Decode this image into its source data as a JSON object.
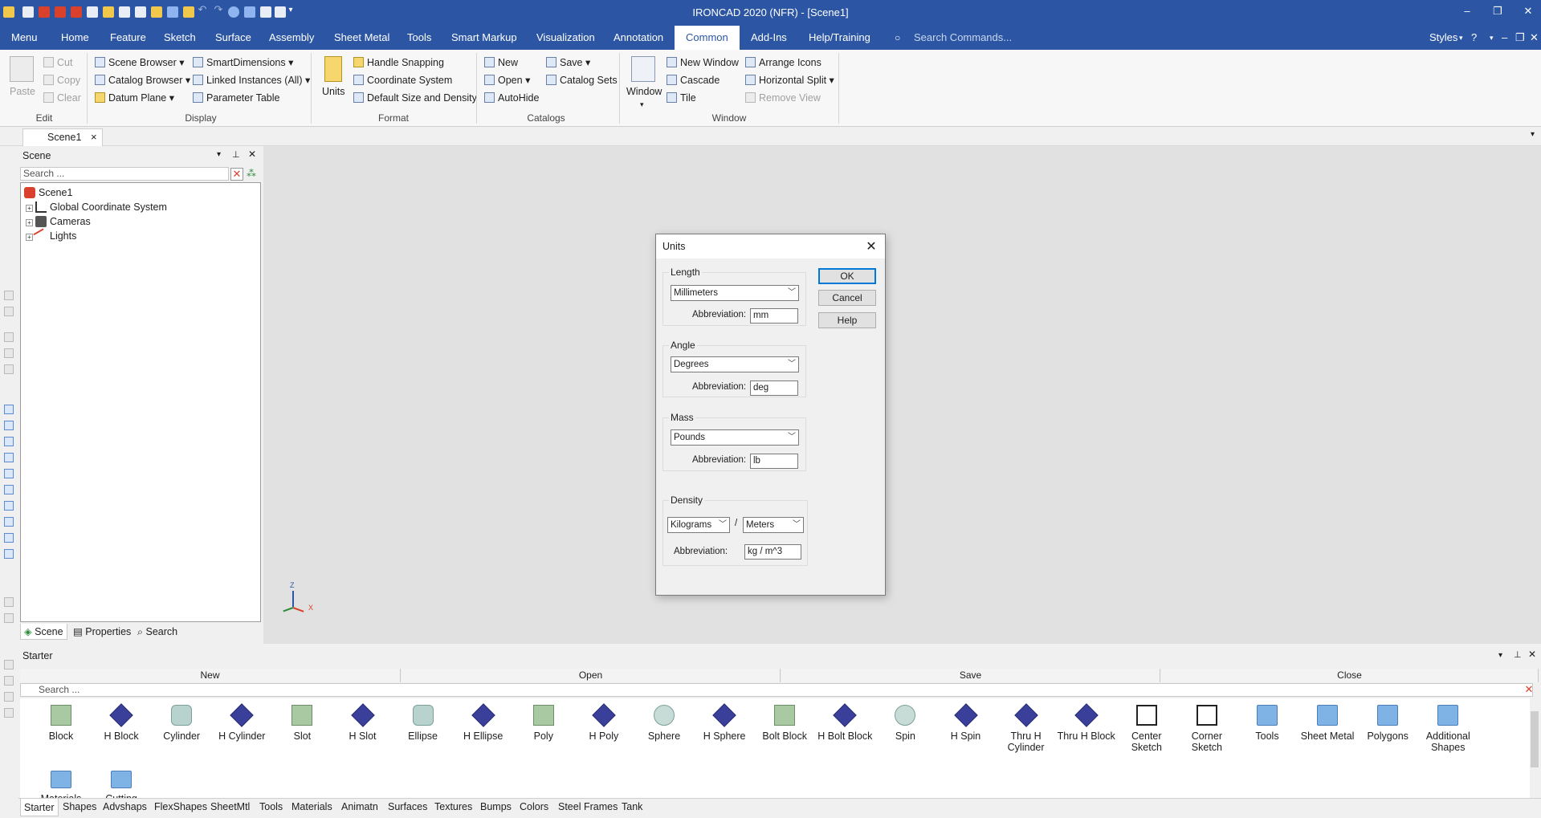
{
  "window": {
    "title": "IRONCAD 2020 (NFR) - [Scene1]",
    "minimize": "–",
    "maximize": "❐",
    "close": "✕"
  },
  "menu_tabs": [
    "Menu",
    "Home",
    "Feature",
    "Sketch",
    "Surface",
    "Assembly",
    "Sheet Metal",
    "Tools",
    "Smart Markup",
    "Visualization",
    "Annotation",
    "Common",
    "Add-Ins",
    "Help/Training"
  ],
  "active_tab": "Common",
  "search_commands": {
    "placeholder": "Search Commands..."
  },
  "styles_label": "Styles",
  "ribbon": {
    "edit": {
      "paste": "Paste",
      "cut": "Cut",
      "copy": "Copy",
      "clear": "Clear",
      "group": "Edit"
    },
    "display": {
      "scene_browser": "Scene Browser",
      "catalog_browser": "Catalog Browser",
      "datum_plane": "Datum Plane",
      "smart_dimensions": "SmartDimensions",
      "linked_instances": "Linked Instances (All)",
      "parameter_table": "Parameter Table",
      "group": "Display"
    },
    "format": {
      "units": "Units",
      "handle_snapping": "Handle Snapping",
      "coordinate_system": "Coordinate System",
      "default_size": "Default Size and Density",
      "group": "Format"
    },
    "catalogs": {
      "new": "New",
      "open": "Open",
      "autohide": "AutoHide",
      "save": "Save",
      "catalog_sets": "Catalog Sets",
      "group": "Catalogs"
    },
    "window": {
      "window": "Window",
      "new_window": "New Window",
      "cascade": "Cascade",
      "tile": "Tile",
      "arrange_icons": "Arrange Icons",
      "horizontal_split": "Horizontal Split",
      "remove_view": "Remove View",
      "group": "Window"
    }
  },
  "doc_tab": {
    "label": "Scene1",
    "close": "×"
  },
  "scene_panel": {
    "title": "Scene",
    "search_placeholder": "Search ...",
    "tree": [
      {
        "label": "Scene1"
      },
      {
        "label": "Global Coordinate System"
      },
      {
        "label": "Cameras"
      },
      {
        "label": "Lights"
      }
    ],
    "tabs": [
      "Scene",
      "Properties",
      "Search"
    ]
  },
  "triad": {
    "z": "Z",
    "x": "X"
  },
  "units_dialog": {
    "title": "Units",
    "close": "✕",
    "length": {
      "label": "Length",
      "value": "Millimeters",
      "abbr_label": "Abbreviation:",
      "abbr": "mm"
    },
    "angle": {
      "label": "Angle",
      "value": "Degrees",
      "abbr_label": "Abbreviation:",
      "abbr": "deg"
    },
    "mass": {
      "label": "Mass",
      "value": "Pounds",
      "abbr_label": "Abbreviation:",
      "abbr": "lb"
    },
    "density": {
      "label": "Density",
      "mass_unit": "Kilograms",
      "divider": "/",
      "length_unit": "Meters",
      "abbr_label": "Abbreviation:",
      "abbr": "kg / m^3"
    },
    "buttons": {
      "ok": "OK",
      "cancel": "Cancel",
      "help": "Help"
    }
  },
  "starter": {
    "title": "Starter",
    "cells": [
      "New",
      "Open",
      "Save",
      "Close"
    ],
    "search_placeholder": "Search ...",
    "shapes_row1": [
      {
        "label": "Block"
      },
      {
        "label": "H Block"
      },
      {
        "label": "Cylinder"
      },
      {
        "label": "H Cylinder"
      },
      {
        "label": "Slot"
      },
      {
        "label": "H Slot"
      },
      {
        "label": "Ellipse"
      },
      {
        "label": "H Ellipse"
      },
      {
        "label": "Poly"
      },
      {
        "label": "H Poly"
      },
      {
        "label": "Sphere"
      },
      {
        "label": "H Sphere"
      },
      {
        "label": "Bolt Block"
      },
      {
        "label": "H Bolt Block"
      },
      {
        "label": "Spin"
      },
      {
        "label": "H Spin"
      },
      {
        "label": "Thru H\nCylinder"
      },
      {
        "label": "Thru H Block"
      },
      {
        "label": "Center\nSketch"
      },
      {
        "label": "Corner\nSketch"
      },
      {
        "label": "Tools"
      },
      {
        "label": "Sheet Metal"
      },
      {
        "label": "Polygons"
      },
      {
        "label": "Additional\nShapes"
      }
    ],
    "shapes_row2": [
      {
        "label": "Materials"
      },
      {
        "label": "Cutting"
      }
    ]
  },
  "catalog_tabs": [
    "Starter",
    "Shapes",
    "Advshaps",
    "FlexShapes",
    "SheetMtl",
    "Tools",
    "Materials",
    "Animatn",
    "Surfaces",
    "Textures",
    "Bumps",
    "Colors",
    "Steel Frames",
    "Tank"
  ],
  "colors": {
    "accent": "#2c56a4",
    "viewport": "#e1e1e1"
  }
}
